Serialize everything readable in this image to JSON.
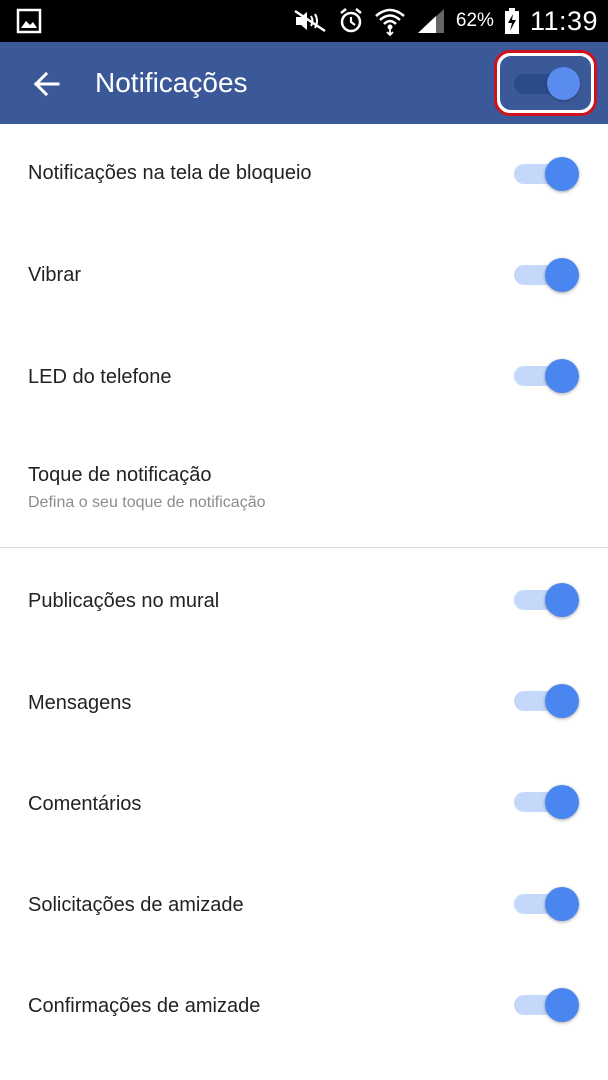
{
  "status_bar": {
    "battery_percent": "62%",
    "time": "11:39",
    "icons": [
      "gallery-icon",
      "mute-icon",
      "alarm-icon",
      "wifi-icon",
      "signal-icon",
      "battery-charging-icon"
    ]
  },
  "app_bar": {
    "title": "Notificações",
    "back_icon": "back-arrow-icon",
    "master_toggle_on": true
  },
  "settings": [
    {
      "label": "Notificações na tela de bloqueio",
      "toggle_on": true
    },
    {
      "label": "Vibrar",
      "toggle_on": true
    },
    {
      "label": "LED do telefone",
      "toggle_on": true
    },
    {
      "label": "Toque de notificação",
      "sublabel": "Defina o seu toque de notificação"
    },
    {
      "label": "Publicações no mural",
      "toggle_on": true
    },
    {
      "label": "Mensagens",
      "toggle_on": true
    },
    {
      "label": "Comentários",
      "toggle_on": true
    },
    {
      "label": "Solicitações de amizade",
      "toggle_on": true
    },
    {
      "label": "Confirmações de amizade",
      "toggle_on": true
    }
  ],
  "colors": {
    "app_bar": "#3b5998",
    "toggle_thumb": "#4a86f0",
    "toggle_track": "#c6d8f9",
    "highlight": "#d0121c"
  }
}
